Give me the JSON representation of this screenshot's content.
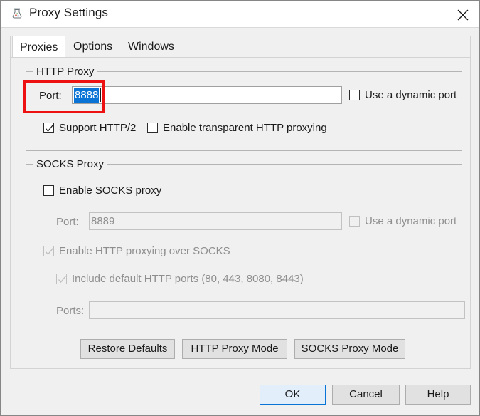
{
  "window": {
    "title": "Proxy Settings",
    "icon": "proxy-jar-icon",
    "close_label": "×"
  },
  "tabs": [
    {
      "label": "Proxies",
      "active": true
    },
    {
      "label": "Options",
      "active": false
    },
    {
      "label": "Windows",
      "active": false
    }
  ],
  "http_proxy": {
    "legend": "HTTP Proxy",
    "port_label": "Port:",
    "port_value": "8888",
    "port_selected": true,
    "dynamic_port_label": "Use a dynamic port",
    "dynamic_port_checked": false,
    "support_http2_label": "Support HTTP/2",
    "support_http2_checked": true,
    "transparent_label": "Enable transparent HTTP proxying",
    "transparent_checked": false
  },
  "socks_proxy": {
    "legend": "SOCKS Proxy",
    "enable_label": "Enable SOCKS proxy",
    "enable_checked": false,
    "port_label": "Port:",
    "port_value": "8889",
    "port_disabled": true,
    "dynamic_port_label": "Use a dynamic port",
    "dynamic_port_checked": false,
    "http_over_socks_label": "Enable HTTP proxying over SOCKS",
    "http_over_socks_checked": true,
    "default_ports_label": "Include default HTTP ports (80, 443, 8080, 8443)",
    "default_ports_checked": true,
    "ports_label": "Ports:",
    "ports_value": "",
    "ports_disabled": true
  },
  "mode_buttons": {
    "restore_defaults": "Restore Defaults",
    "http_proxy_mode": "HTTP Proxy Mode",
    "socks_proxy_mode": "SOCKS Proxy Mode"
  },
  "dialog_buttons": {
    "ok": "OK",
    "cancel": "Cancel",
    "help": "Help"
  },
  "colors": {
    "selection_blue": "#0a74d6",
    "annotation_red": "#ee1111",
    "default_button_fill": "#e2effb",
    "dialog_bg": "#f0f0f0"
  }
}
